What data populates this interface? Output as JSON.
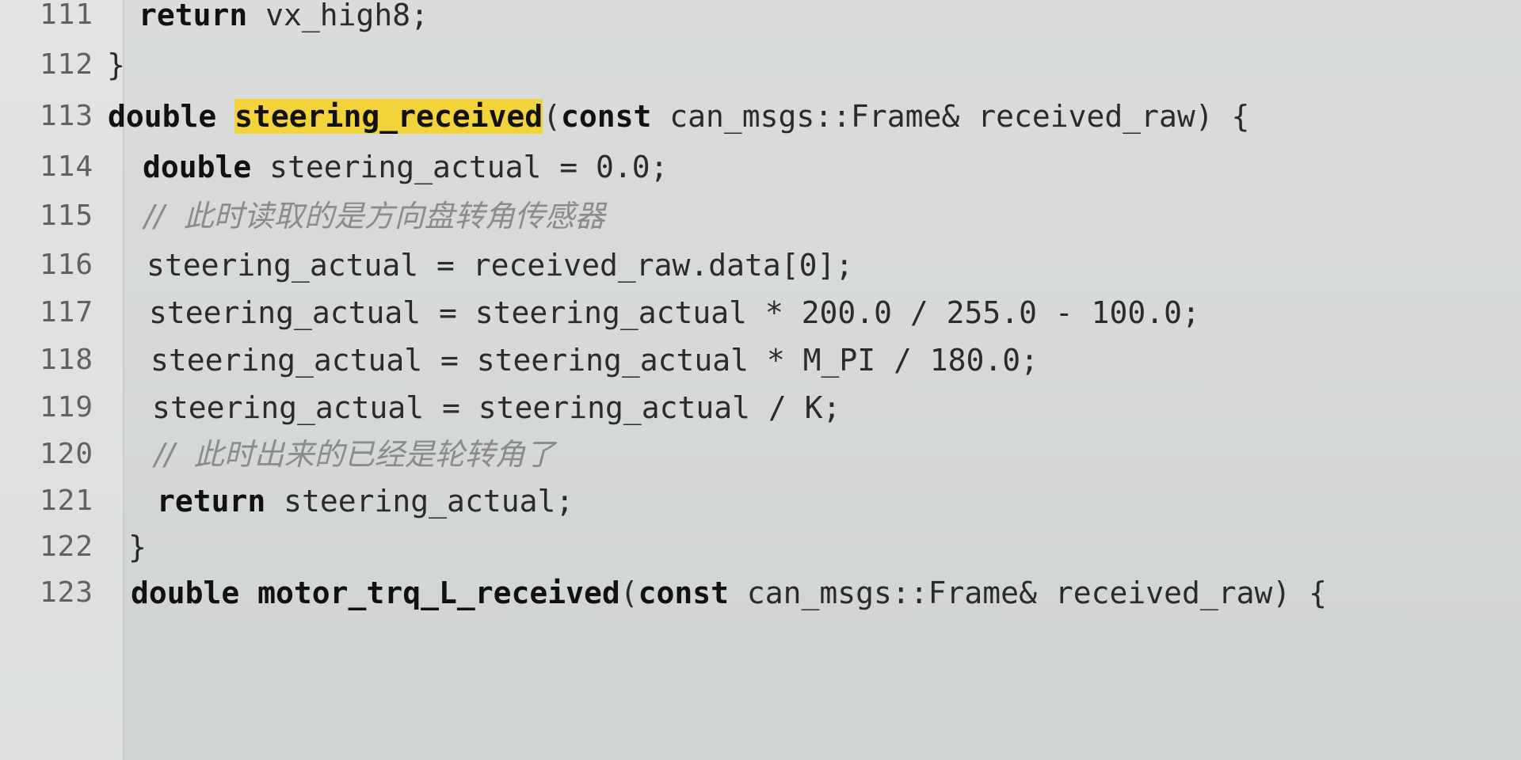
{
  "lines": [
    {
      "num": "111",
      "t1": "return",
      "t2": " vx_high8;"
    },
    {
      "num": "112",
      "t1": "}"
    },
    {
      "num": "113",
      "kw": "double",
      "fn": "steering_received",
      "rest1": "(",
      "kw2": "const",
      "rest2": " can_msgs::Frame& received_raw) {"
    },
    {
      "num": "114",
      "kw": "double",
      "rest": " steering_actual = 0.0;"
    },
    {
      "num": "115",
      "comment": "//  此时读取的是方向盘转角传感器"
    },
    {
      "num": "116",
      "text": "steering_actual = received_raw.data[0];"
    },
    {
      "num": "117",
      "text": "steering_actual = steering_actual * 200.0 / 255.0 - 100.0;"
    },
    {
      "num": "118",
      "text": "steering_actual = steering_actual * M_PI / 180.0;"
    },
    {
      "num": "119",
      "text": "steering_actual = steering_actual / K;"
    },
    {
      "num": "120",
      "comment": "//  此时出来的已经是轮转角了"
    },
    {
      "num": "121",
      "kw": "return",
      "rest": " steering_actual;"
    },
    {
      "num": "122",
      "text": "}"
    },
    {
      "num": "123",
      "kw": "double",
      "fn": "motor_trq_L_received",
      "rest1": "(",
      "kw2": "const",
      "rest2": " can_msgs::Frame& received_raw) {"
    }
  ]
}
